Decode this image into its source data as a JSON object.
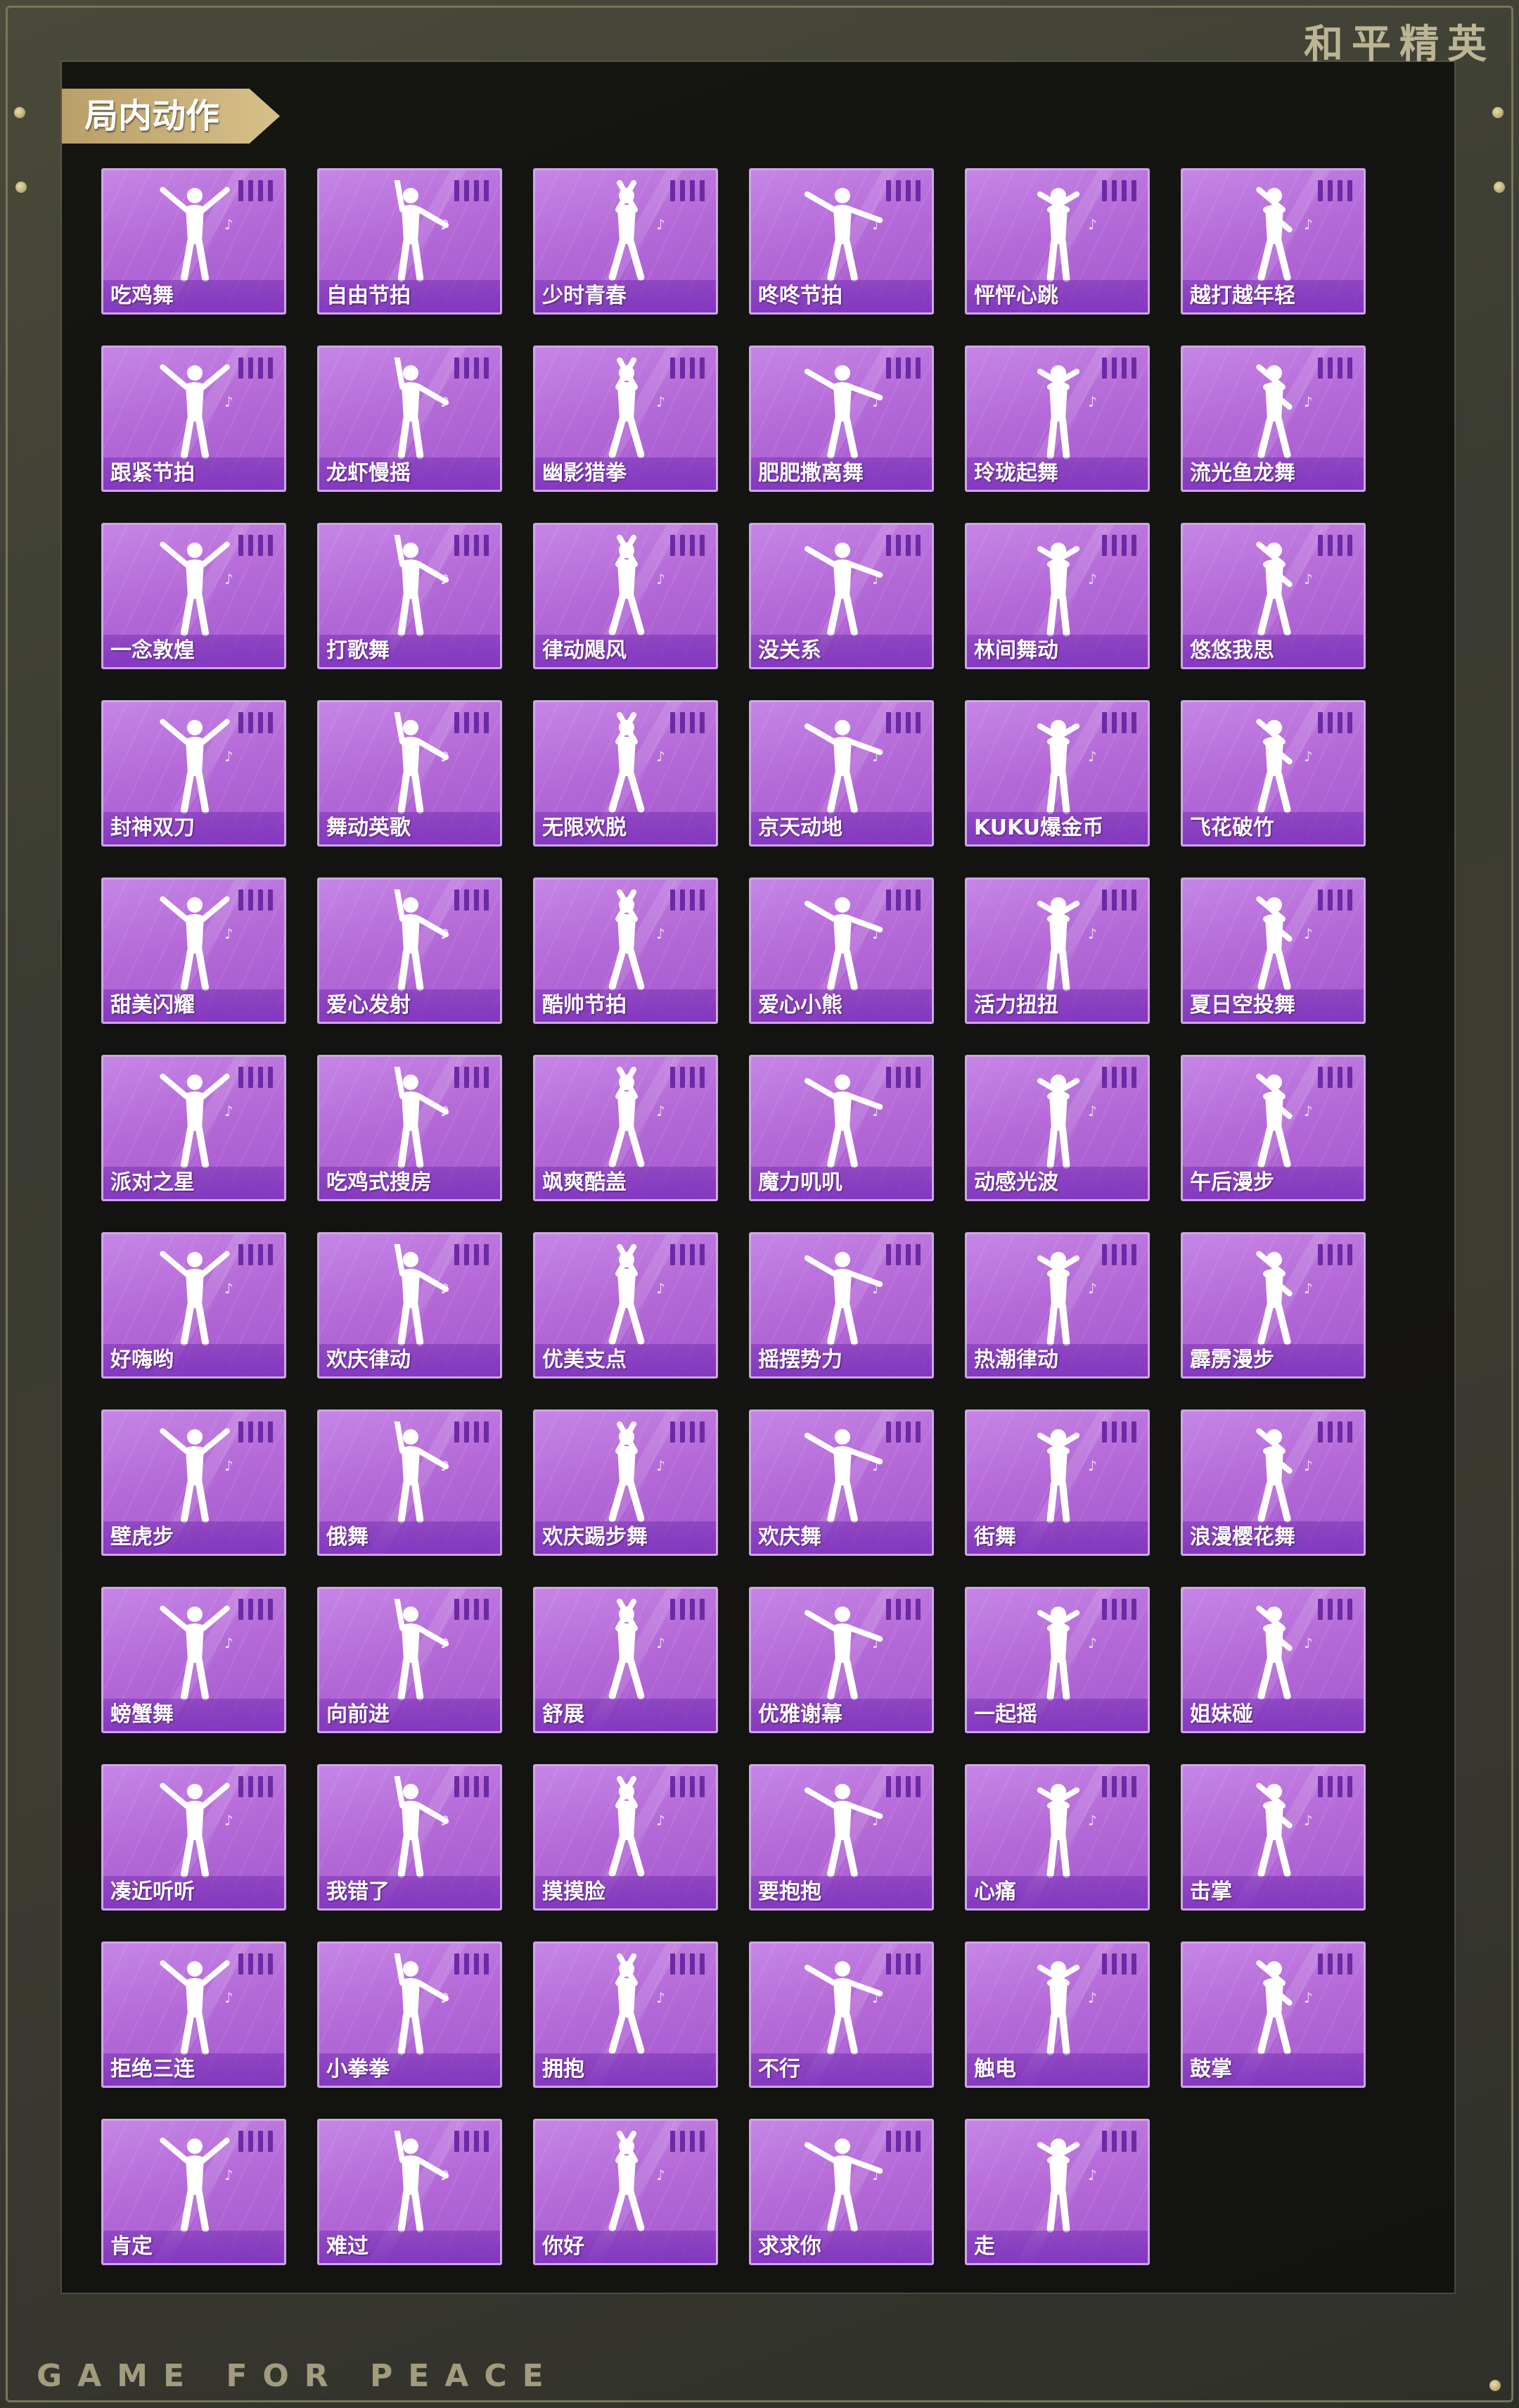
{
  "brand": {
    "title": "和平精英",
    "footer": "GAME FOR PEACE"
  },
  "section": {
    "title": "局内动作"
  },
  "colors": {
    "card_fill": "#b56ad8",
    "card_border": "#cfa6e6",
    "tier_bar": "#6c2aa4",
    "tag_gold": "#c9b07a"
  },
  "emotes": [
    "吃鸡舞",
    "自由节拍",
    "少时青春",
    "咚咚节拍",
    "怦怦心跳",
    "越打越年轻",
    "跟紧节拍",
    "龙虾慢摇",
    "幽影猎拳",
    "肥肥撒离舞",
    "玲珑起舞",
    "流光鱼龙舞",
    "一念敦煌",
    "打歌舞",
    "律动飓风",
    "没关系",
    "林间舞动",
    "悠悠我思",
    "封神双刀",
    "舞动英歌",
    "无限欢脱",
    "京天动地",
    "KUKU爆金币",
    "飞花破竹",
    "甜美闪耀",
    "爱心发射",
    "酷帅节拍",
    "爱心小熊",
    "活力扭扭",
    "夏日空投舞",
    "派对之星",
    "吃鸡式搜房",
    "飒爽酷盖",
    "魔力叽叽",
    "动感光波",
    "午后漫步",
    "好嗨哟",
    "欢庆律动",
    "优美支点",
    "摇摆势力",
    "热潮律动",
    "霹雳漫步",
    "壁虎步",
    "俄舞",
    "欢庆踢步舞",
    "欢庆舞",
    "街舞",
    "浪漫樱花舞",
    "螃蟹舞",
    "向前进",
    "舒展",
    "优雅谢幕",
    "一起摇",
    "姐妹碰",
    "凑近听听",
    "我错了",
    "摸摸脸",
    "要抱抱",
    "心痛",
    "击掌",
    "拒绝三连",
    "小拳拳",
    "拥抱",
    "不行",
    "触电",
    "鼓掌",
    "肯定",
    "难过",
    "你好",
    "求求你",
    "走"
  ]
}
